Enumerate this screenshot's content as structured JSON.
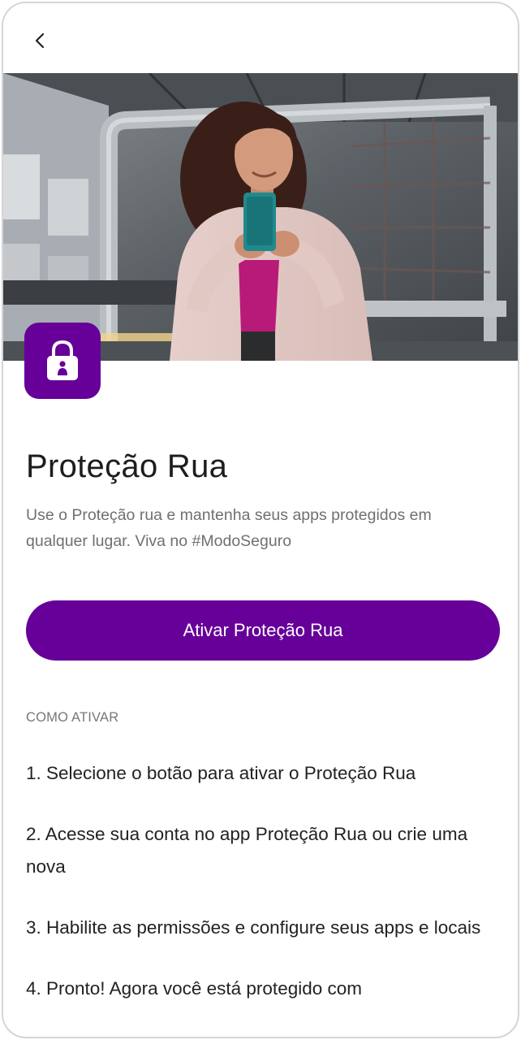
{
  "header": {
    "back_icon": "chevron-left-icon"
  },
  "hero": {
    "badge_icon": "padlock-person-icon"
  },
  "product": {
    "title": "Proteção Rua",
    "description": "Use o Proteção rua e mantenha seus apps protegidos em qualquer lugar. Viva no #ModoSeguro"
  },
  "cta": {
    "label": "Ativar Proteção Rua"
  },
  "instructions": {
    "heading": "COMO ATIVAR",
    "steps": [
      "1. Selecione o botão para ativar o Proteção Rua",
      "2. Acesse sua conta no app Proteção Rua ou crie uma nova",
      "3. Habilite as permissões e configure seus apps e locais",
      "4. Pronto! Agora você está protegido com"
    ]
  },
  "colors": {
    "brand_purple": "#660099",
    "text_primary": "#1d1d1d",
    "text_secondary": "#707070",
    "background": "#ffffff"
  }
}
